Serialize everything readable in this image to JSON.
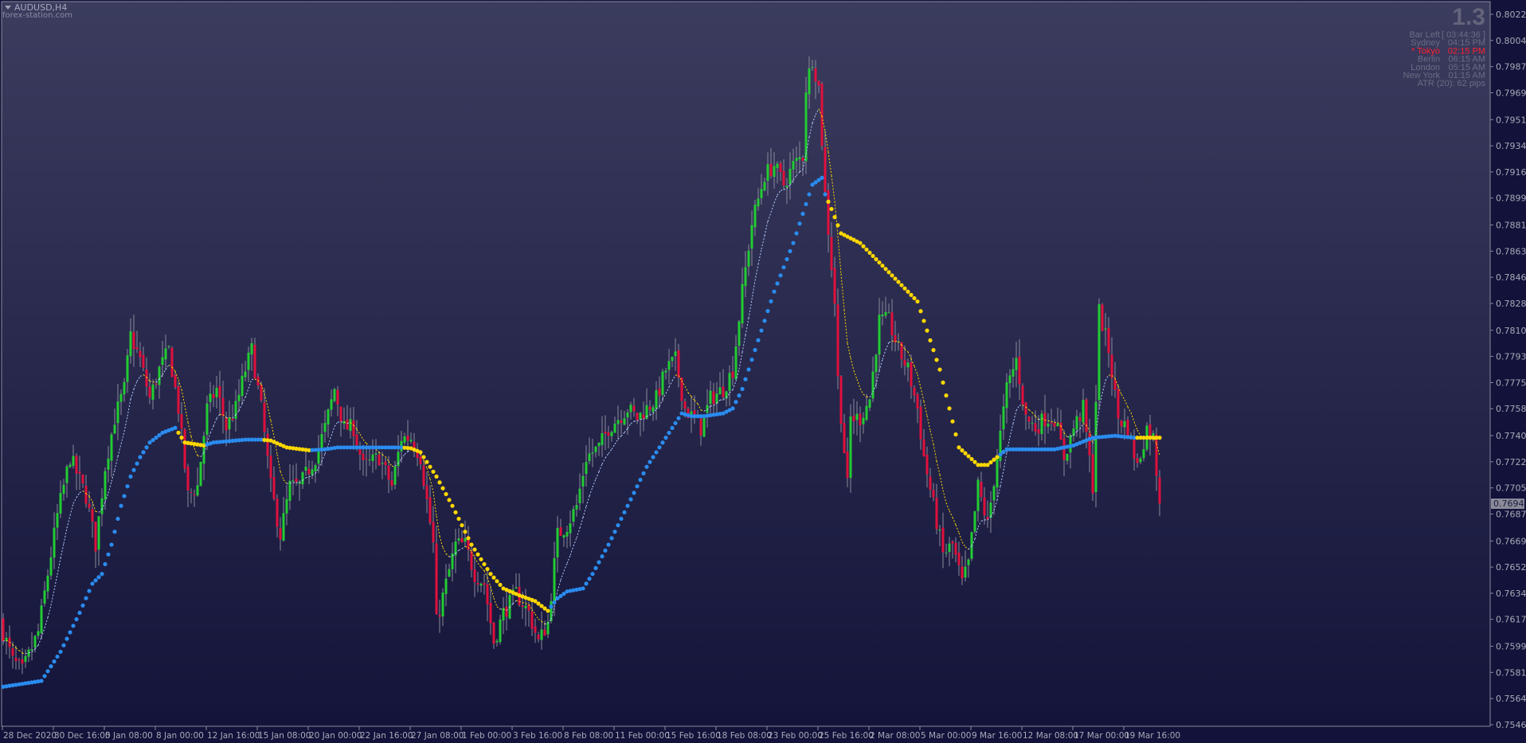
{
  "header": {
    "symbol": "AUDUSD,H4",
    "site": "forex-station.com"
  },
  "info_panel": {
    "version": "1.3",
    "rows": [
      {
        "label": "Bar Left",
        "value": "[ 03:44:36 ]",
        "highlight": false
      },
      {
        "label": "Sydney",
        "value": "04:15 PM",
        "highlight": false
      },
      {
        "label": "* Tokyo",
        "value": "02:15 PM",
        "highlight": true
      },
      {
        "label": "Berlin",
        "value": "06:15 AM",
        "highlight": false
      },
      {
        "label": "London",
        "value": "05:15 AM",
        "highlight": false
      },
      {
        "label": "New York",
        "value": "01:15 AM",
        "highlight": false
      }
    ],
    "atr": "ATR (20): 62 pips",
    "highlight_color": "#ff2030"
  },
  "colors": {
    "bull": "#22cc33",
    "bear": "#e0103c",
    "wick": "#8a8a9a",
    "ma_up": "#2a8cf0",
    "ma_down": "#ffd700",
    "signal_up": "#b4ccff",
    "signal_down": "#ffd700",
    "bg_top": "#3b3c5e",
    "bg_bottom": "#14143a"
  },
  "chart_data": {
    "type": "candlestick",
    "symbol": "AUDUSD",
    "timeframe": "H4",
    "ylim": [
      0.75465,
      0.8022
    ],
    "current_price": "0.76945",
    "y_ticks": [
      "0.80220",
      "0.80045",
      "0.79870",
      "0.79695",
      "0.79515",
      "0.79340",
      "0.79165",
      "0.78990",
      "0.78810",
      "0.78635",
      "0.78460",
      "0.78285",
      "0.78105",
      "0.77930",
      "0.77755",
      "0.77580",
      "0.77400",
      "0.77225",
      "0.77050",
      "0.76875",
      "0.76695",
      "0.76520",
      "0.76345",
      "0.76170",
      "0.75990",
      "0.75815",
      "0.75640",
      "0.75465"
    ],
    "x_ticks": [
      "28 Dec 2020",
      "30 Dec 16:00",
      "5 Jan 08:00",
      "8 Jan 00:00",
      "12 Jan 16:00",
      "15 Jan 08:00",
      "20 Jan 00:00",
      "22 Jan 16:00",
      "27 Jan 08:00",
      "1 Feb 00:00",
      "3 Feb 16:00",
      "8 Feb 08:00",
      "11 Feb 00:00",
      "15 Feb 16:00",
      "18 Feb 08:00",
      "23 Feb 00:00",
      "25 Feb 16:00",
      "2 Mar 08:00",
      "5 Mar 00:00",
      "9 Mar 16:00",
      "12 Mar 08:00",
      "17 Mar 00:00",
      "19 Mar 16:00"
    ],
    "bars_per_x_tick": 16,
    "close_path_bar_price": [
      [
        0,
        0.76084
      ],
      [
        3,
        0.75888
      ],
      [
        6,
        0.75823
      ],
      [
        11,
        0.76084
      ],
      [
        14,
        0.76474
      ],
      [
        17,
        0.76865
      ],
      [
        21,
        0.77256
      ],
      [
        26,
        0.76996
      ],
      [
        29,
        0.7667
      ],
      [
        32,
        0.77191
      ],
      [
        35,
        0.77517
      ],
      [
        38,
        0.77712
      ],
      [
        40,
        0.7807
      ],
      [
        43,
        0.77908
      ],
      [
        46,
        0.77647
      ],
      [
        49,
        0.77842
      ],
      [
        52,
        0.77973
      ],
      [
        55,
        0.77582
      ],
      [
        58,
        0.76996
      ],
      [
        61,
        0.77061
      ],
      [
        64,
        0.77582
      ],
      [
        67,
        0.77712
      ],
      [
        70,
        0.77452
      ],
      [
        73,
        0.77582
      ],
      [
        76,
        0.77842
      ],
      [
        78,
        0.77973
      ],
      [
        81,
        0.77582
      ],
      [
        84,
        0.77061
      ],
      [
        87,
        0.76735
      ],
      [
        90,
        0.77061
      ],
      [
        93,
        0.77061
      ],
      [
        98,
        0.77256
      ],
      [
        101,
        0.77452
      ],
      [
        104,
        0.77712
      ],
      [
        107,
        0.77452
      ],
      [
        110,
        0.77452
      ],
      [
        113,
        0.77191
      ],
      [
        118,
        0.77256
      ],
      [
        122,
        0.77061
      ],
      [
        125,
        0.77386
      ],
      [
        128,
        0.77386
      ],
      [
        131,
        0.77256
      ],
      [
        135,
        0.7667
      ],
      [
        136,
        0.76149
      ],
      [
        139,
        0.76409
      ],
      [
        142,
        0.7667
      ],
      [
        145,
        0.7667
      ],
      [
        148,
        0.76474
      ],
      [
        151,
        0.76409
      ],
      [
        154,
        0.76018
      ],
      [
        157,
        0.76214
      ],
      [
        161,
        0.76344
      ],
      [
        165,
        0.76214
      ],
      [
        168,
        0.76018
      ],
      [
        171,
        0.76149
      ],
      [
        174,
        0.76735
      ],
      [
        177,
        0.768
      ],
      [
        180,
        0.7693
      ],
      [
        183,
        0.77256
      ],
      [
        187,
        0.77321
      ],
      [
        190,
        0.77452
      ],
      [
        193,
        0.77517
      ],
      [
        196,
        0.77582
      ],
      [
        199,
        0.77517
      ],
      [
        202,
        0.77582
      ],
      [
        205,
        0.77647
      ],
      [
        208,
        0.77842
      ],
      [
        211,
        0.77908
      ],
      [
        214,
        0.77582
      ],
      [
        219,
        0.77452
      ],
      [
        222,
        0.77647
      ],
      [
        226,
        0.77712
      ],
      [
        229,
        0.77842
      ],
      [
        232,
        0.78364
      ],
      [
        235,
        0.78819
      ],
      [
        239,
        0.79145
      ],
      [
        242,
        0.7921
      ],
      [
        245,
        0.7908
      ],
      [
        248,
        0.7921
      ],
      [
        251,
        0.79275
      ],
      [
        252,
        0.79731
      ],
      [
        254,
        0.79927
      ],
      [
        256,
        0.79731
      ],
      [
        258,
        0.79015
      ],
      [
        261,
        0.78298
      ],
      [
        262,
        0.77777
      ],
      [
        265,
        0.77061
      ],
      [
        266,
        0.77517
      ],
      [
        269,
        0.77517
      ],
      [
        272,
        0.77647
      ],
      [
        275,
        0.78168
      ],
      [
        278,
        0.78168
      ],
      [
        281,
        0.77973
      ],
      [
        284,
        0.77842
      ],
      [
        287,
        0.77582
      ],
      [
        289,
        0.77256
      ],
      [
        292,
        0.7693
      ],
      [
        295,
        0.76605
      ],
      [
        298,
        0.7667
      ],
      [
        301,
        0.76409
      ],
      [
        303,
        0.7654
      ],
      [
        306,
        0.77061
      ],
      [
        309,
        0.768
      ],
      [
        312,
        0.77256
      ],
      [
        315,
        0.77712
      ],
      [
        318,
        0.77908
      ],
      [
        321,
        0.77517
      ],
      [
        324,
        0.77452
      ],
      [
        327,
        0.77517
      ],
      [
        330,
        0.77517
      ],
      [
        333,
        0.77256
      ],
      [
        336,
        0.77452
      ],
      [
        339,
        0.77582
      ],
      [
        342,
        0.77061
      ],
      [
        344,
        0.78233
      ],
      [
        347,
        0.77973
      ],
      [
        350,
        0.77517
      ],
      [
        353,
        0.77452
      ],
      [
        356,
        0.77191
      ],
      [
        359,
        0.77452
      ],
      [
        361,
        0.77386
      ],
      [
        363,
        0.76945
      ]
    ],
    "ma_bar_price_trend": [
      [
        0,
        0.75719,
        "up"
      ],
      [
        12,
        0.75758,
        "up"
      ],
      [
        18,
        0.75953,
        "up"
      ],
      [
        24,
        0.76214,
        "up"
      ],
      [
        28,
        0.76409,
        "up"
      ],
      [
        31,
        0.76474,
        "up"
      ],
      [
        34,
        0.7667,
        "up"
      ],
      [
        37,
        0.7693,
        "up"
      ],
      [
        40,
        0.77126,
        "up"
      ],
      [
        43,
        0.77256,
        "up"
      ],
      [
        46,
        0.77354,
        "up"
      ],
      [
        50,
        0.77419,
        "up"
      ],
      [
        54,
        0.77452,
        "up"
      ],
      [
        57,
        0.77354,
        "down"
      ],
      [
        63,
        0.77334,
        "down"
      ],
      [
        66,
        0.77354,
        "up"
      ],
      [
        76,
        0.77373,
        "up"
      ],
      [
        81,
        0.77373,
        "up"
      ],
      [
        84,
        0.77367,
        "down"
      ],
      [
        89,
        0.77321,
        "down"
      ],
      [
        96,
        0.77302,
        "down"
      ],
      [
        101,
        0.77308,
        "up"
      ],
      [
        105,
        0.77321,
        "up"
      ],
      [
        125,
        0.77321,
        "up"
      ],
      [
        128,
        0.77315,
        "down"
      ],
      [
        131,
        0.77289,
        "down"
      ],
      [
        136,
        0.77126,
        "down"
      ],
      [
        141,
        0.7693,
        "down"
      ],
      [
        147,
        0.7667,
        "down"
      ],
      [
        153,
        0.76474,
        "down"
      ],
      [
        157,
        0.76377,
        "down"
      ],
      [
        162,
        0.76331,
        "down"
      ],
      [
        167,
        0.76292,
        "down"
      ],
      [
        171,
        0.76227,
        "down"
      ],
      [
        174,
        0.76311,
        "up"
      ],
      [
        177,
        0.76357,
        "up"
      ],
      [
        182,
        0.76377,
        "up"
      ],
      [
        185,
        0.76474,
        "up"
      ],
      [
        190,
        0.7667,
        "up"
      ],
      [
        196,
        0.7693,
        "up"
      ],
      [
        202,
        0.77191,
        "up"
      ],
      [
        208,
        0.77386,
        "up"
      ],
      [
        213,
        0.77549,
        "up"
      ],
      [
        216,
        0.7753,
        "up"
      ],
      [
        220,
        0.7753,
        "up"
      ],
      [
        226,
        0.77549,
        "up"
      ],
      [
        229,
        0.77582,
        "up"
      ],
      [
        232,
        0.77712,
        "up"
      ],
      [
        235,
        0.77908,
        "up"
      ],
      [
        242,
        0.78364,
        "up"
      ],
      [
        248,
        0.78689,
        "up"
      ],
      [
        254,
        0.7908,
        "up"
      ],
      [
        257,
        0.79126,
        "up"
      ],
      [
        258,
        0.79015,
        "up"
      ],
      [
        260,
        0.78917,
        "down"
      ],
      [
        263,
        0.78754,
        "down"
      ],
      [
        269,
        0.78689,
        "down"
      ],
      [
        275,
        0.78559,
        "down"
      ],
      [
        281,
        0.78429,
        "down"
      ],
      [
        287,
        0.78298,
        "down"
      ],
      [
        290,
        0.78103,
        "down"
      ],
      [
        294,
        0.77842,
        "down"
      ],
      [
        297,
        0.77582,
        "down"
      ],
      [
        300,
        0.77321,
        "down"
      ],
      [
        306,
        0.77204,
        "down"
      ],
      [
        309,
        0.77204,
        "down"
      ],
      [
        312,
        0.77256,
        "down"
      ],
      [
        315,
        0.77308,
        "up"
      ],
      [
        320,
        0.77308,
        "up"
      ],
      [
        330,
        0.77308,
        "up"
      ],
      [
        336,
        0.77334,
        "up"
      ],
      [
        342,
        0.77386,
        "up"
      ],
      [
        349,
        0.77399,
        "up"
      ],
      [
        355,
        0.77386,
        "up"
      ],
      [
        363,
        0.77386,
        "down"
      ]
    ]
  }
}
